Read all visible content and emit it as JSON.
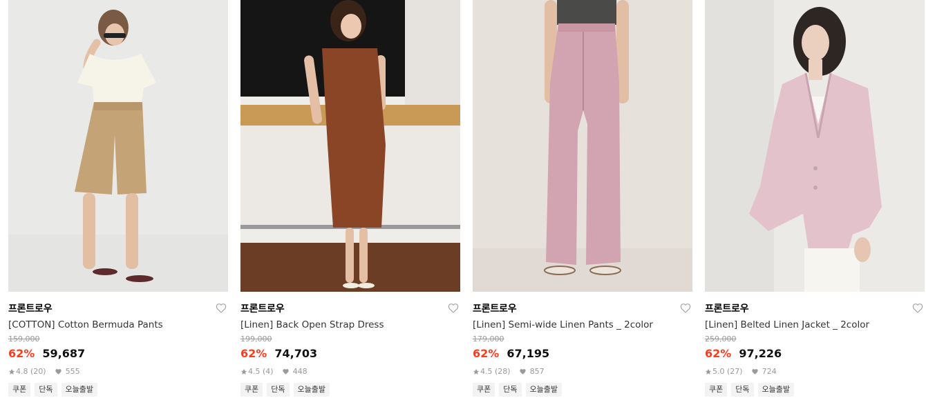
{
  "products": [
    {
      "brand": "프론트로우",
      "title": "[COTTON] Cotton Bermuda Pants",
      "original_price": "159,000",
      "discount": "62%",
      "price": "59,687",
      "rating": "4.8",
      "reviews": "(20)",
      "likes": "555",
      "tags": [
        "쿠폰",
        "단독",
        "오늘출발"
      ],
      "image": "woman in white knit top and tan bermuda shorts"
    },
    {
      "brand": "프론트로우",
      "title": "[Linen] Back Open Strap Dress",
      "original_price": "199,000",
      "discount": "62%",
      "price": "74,703",
      "rating": "4.5",
      "reviews": "(4)",
      "likes": "448",
      "tags": [
        "쿠폰",
        "단독",
        "오늘출발"
      ],
      "image": "woman in brown linen strap dress leaning on counter"
    },
    {
      "brand": "프론트로우",
      "title": "[Linen] Semi-wide Linen Pants _ 2color",
      "original_price": "179,000",
      "discount": "62%",
      "price": "67,195",
      "rating": "4.5",
      "reviews": "(28)",
      "likes": "857",
      "tags": [
        "쿠폰",
        "단독",
        "오늘출발"
      ],
      "image": "pink semi-wide linen pants"
    },
    {
      "brand": "프론트로우",
      "title": "[Linen] Belted Linen Jacket _ 2color",
      "original_price": "259,000",
      "discount": "62%",
      "price": "97,226",
      "rating": "5.0",
      "reviews": "(27)",
      "likes": "724",
      "tags": [
        "쿠폰",
        "단독",
        "오늘출발"
      ],
      "image": "woman in pink linen jacket and white pants"
    }
  ],
  "colors": {
    "discount": "#ff3b1e",
    "tag_bg": "#f3f3f3",
    "meta": "#999999"
  },
  "icons": [
    "heart-outline-icon",
    "star-icon",
    "heart-filled-icon"
  ]
}
